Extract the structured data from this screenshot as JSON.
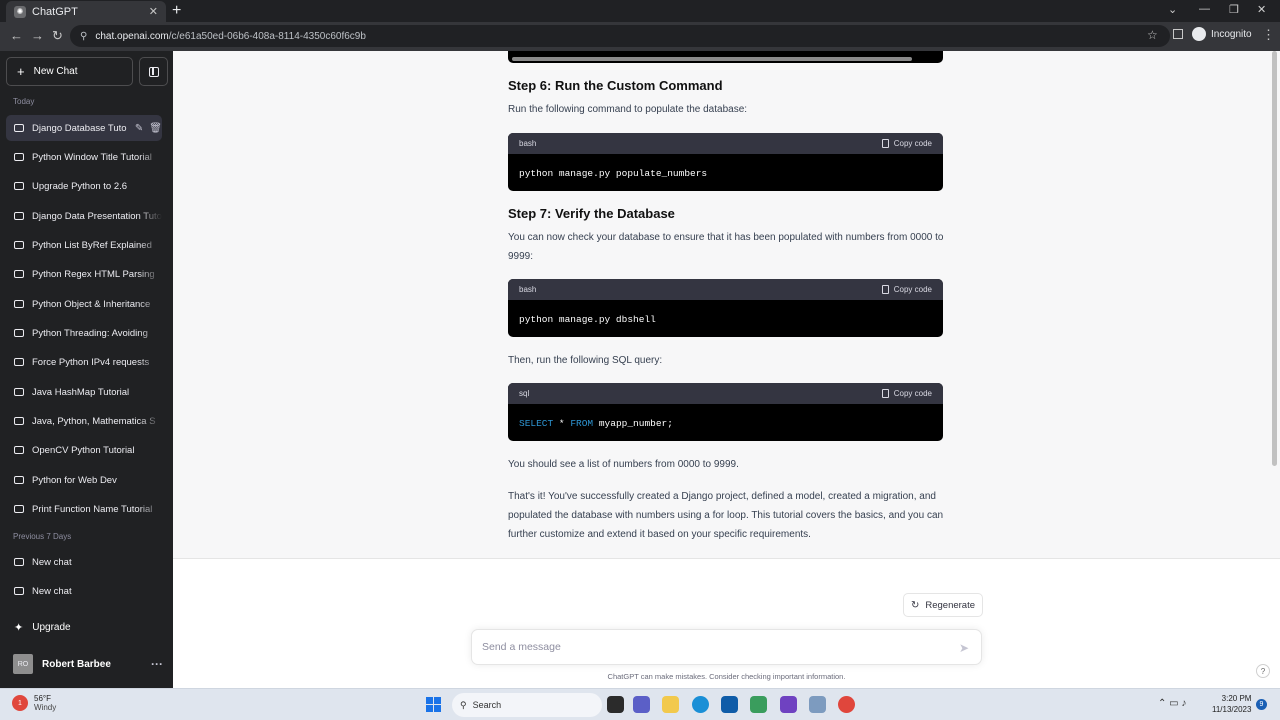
{
  "browser": {
    "tab_title": "ChatGPT",
    "tab_close": "✕",
    "new_tab": "+",
    "url_host": "chat.openai.com",
    "url_path": "/c/e61a50ed-06b6-408a-8114-4350c60f6c9b",
    "incognito_label": "Incognito"
  },
  "sidebar": {
    "new_chat_label": "New Chat",
    "today_label": "Today",
    "previous_label": "Previous 7 Days",
    "today_items": [
      {
        "label": "Django Database Tuto"
      },
      {
        "label": "Python Window Title Tutorial"
      },
      {
        "label": "Upgrade Python to 2.6"
      },
      {
        "label": "Django Data Presentation Tutorial"
      },
      {
        "label": "Python List ByRef Explained"
      },
      {
        "label": "Python Regex HTML Parsing"
      },
      {
        "label": "Python Object & Inheritance"
      },
      {
        "label": "Python Threading: Avoiding"
      },
      {
        "label": "Force Python IPv4 requests"
      },
      {
        "label": "Java HashMap Tutorial"
      },
      {
        "label": "Java, Python, Mathematica S"
      },
      {
        "label": "OpenCV Python Tutorial"
      },
      {
        "label": "Python for Web Dev"
      },
      {
        "label": "Print Function Name Tutorial"
      }
    ],
    "previous_items": [
      {
        "label": "New chat"
      },
      {
        "label": "New chat"
      }
    ],
    "upgrade_label": "Upgrade",
    "user_initials": "RO",
    "user_name": "Robert Barbee"
  },
  "conversation": {
    "step6_heading": "Step 6: Run the Custom Command",
    "step6_text": "Run the following command to populate the database:",
    "code1_lang": "bash",
    "code1_body": "python manage.py populate_numbers",
    "step7_heading": "Step 7: Verify the Database",
    "step7_text": "You can now check your database to ensure that it has been populated with numbers from 0000 to 9999:",
    "code2_lang": "bash",
    "code2_body": "python manage.py dbshell",
    "then_text": "Then, run the following SQL query:",
    "code3_lang": "sql",
    "code3_kw1": "SELECT",
    "code3_mid": " * ",
    "code3_kw2": "FROM",
    "code3_rest": " myapp_number;",
    "copy_label": "Copy code",
    "see_text": "You should see a list of numbers from 0000 to 9999.",
    "final_text": "That's it! You've successfully created a Django project, defined a model, created a migration, and populated the database with numbers using a for loop. This tutorial covers the basics, and you can further customize and extend it based on your specific requirements."
  },
  "composer": {
    "regenerate_label": "Regenerate",
    "placeholder": "Send a message",
    "disclaimer": "ChatGPT can make mistakes. Consider checking important information.",
    "help": "?"
  },
  "taskbar": {
    "temperature": "56°F",
    "weather_desc": "Windy",
    "weather_badge": "1",
    "search_label": "Search",
    "time": "3:20 PM",
    "date": "11/13/2023",
    "notif_count": "9"
  },
  "colors": {
    "sidebar_bg": "#202123",
    "code_bg": "#000000",
    "code_header_bg": "#343541",
    "keyword": "#2e95d3"
  }
}
